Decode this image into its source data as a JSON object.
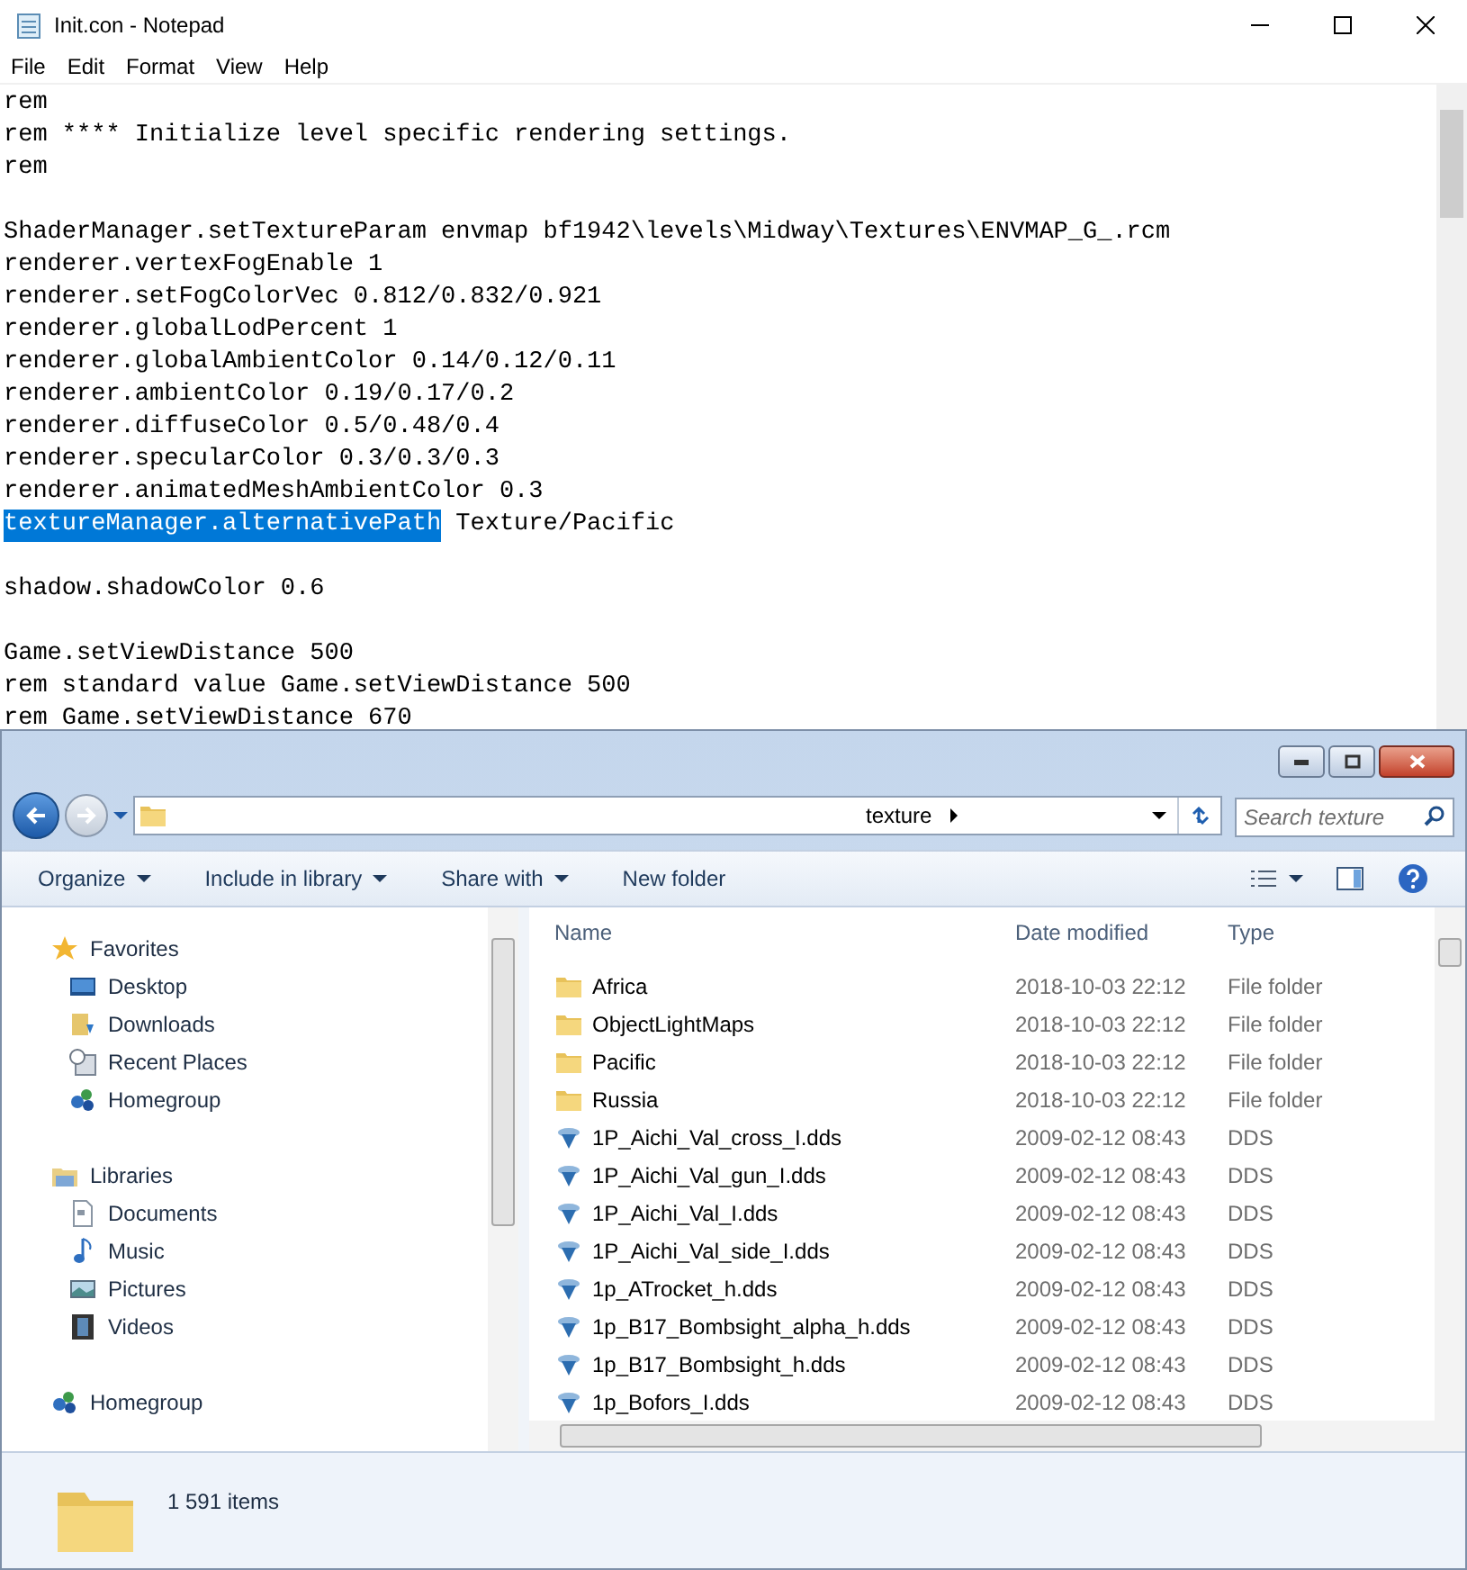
{
  "notepad": {
    "title": "Init.con - Notepad",
    "menu": [
      "File",
      "Edit",
      "Format",
      "View",
      "Help"
    ],
    "lines": [
      {
        "kind": "text",
        "text": "rem"
      },
      {
        "kind": "text",
        "text": "rem **** Initialize level specific rendering settings."
      },
      {
        "kind": "text",
        "text": "rem"
      },
      {
        "kind": "blank"
      },
      {
        "kind": "text",
        "text": "ShaderManager.setTextureParam envmap bf1942\\levels\\Midway\\Textures\\ENVMAP_G_.rcm"
      },
      {
        "kind": "text",
        "text": "renderer.vertexFogEnable 1"
      },
      {
        "kind": "text",
        "text": "renderer.setFogColorVec 0.812/0.832/0.921"
      },
      {
        "kind": "text",
        "text": "renderer.globalLodPercent 1"
      },
      {
        "kind": "text",
        "text": "renderer.globalAmbientColor 0.14/0.12/0.11"
      },
      {
        "kind": "text",
        "text": "renderer.ambientColor 0.19/0.17/0.2"
      },
      {
        "kind": "text",
        "text": "renderer.diffuseColor 0.5/0.48/0.4"
      },
      {
        "kind": "text",
        "text": "renderer.specularColor 0.3/0.3/0.3"
      },
      {
        "kind": "text",
        "text": "renderer.animatedMeshAmbientColor 0.3"
      },
      {
        "kind": "selection",
        "selected_text": "textureManager.alternativePath",
        "text": " Texture/Pacific"
      },
      {
        "kind": "blank"
      },
      {
        "kind": "text",
        "text": "shadow.shadowColor 0.6"
      },
      {
        "kind": "blank"
      },
      {
        "kind": "text",
        "text": "Game.setViewDistance 500"
      },
      {
        "kind": "text",
        "text": "rem standard value Game.setViewDistance 500"
      },
      {
        "kind": "text",
        "text": "rem Game.setViewDistance 670"
      }
    ]
  },
  "explorer": {
    "address": "texture",
    "search": {
      "placeholder": "Search texture"
    },
    "toolbar": [
      {
        "label": "Organize",
        "dropdown": true
      },
      {
        "label": "Include in library",
        "dropdown": true
      },
      {
        "label": "Share with",
        "dropdown": true
      },
      {
        "label": "New folder",
        "dropdown": false
      }
    ],
    "nav": [
      {
        "label": "Favorites",
        "children": [
          {
            "label": "Desktop"
          },
          {
            "label": "Downloads"
          },
          {
            "label": "Recent Places"
          },
          {
            "label": "Homegroup"
          }
        ]
      },
      {
        "label": "Libraries",
        "children": [
          {
            "label": "Documents"
          },
          {
            "label": "Music"
          },
          {
            "label": "Pictures"
          },
          {
            "label": "Videos"
          }
        ]
      },
      {
        "label": "Homegroup"
      }
    ],
    "columns": [
      "Name",
      "Date modified",
      "Type"
    ],
    "rows": [
      {
        "kind": "folder",
        "name": "Africa",
        "date": "2018-10-03 22:12",
        "type": "File folder"
      },
      {
        "kind": "folder",
        "name": "ObjectLightMaps",
        "date": "2018-10-03 22:12",
        "type": "File folder"
      },
      {
        "kind": "folder",
        "name": "Pacific",
        "date": "2018-10-03 22:12",
        "type": "File folder"
      },
      {
        "kind": "folder",
        "name": "Russia",
        "date": "2018-10-03 22:12",
        "type": "File folder"
      },
      {
        "kind": "dds",
        "name": "1P_Aichi_Val_cross_I.dds",
        "date": "2009-02-12 08:43",
        "type": "DDS"
      },
      {
        "kind": "dds",
        "name": "1P_Aichi_Val_gun_I.dds",
        "date": "2009-02-12 08:43",
        "type": "DDS"
      },
      {
        "kind": "dds",
        "name": "1P_Aichi_Val_I.dds",
        "date": "2009-02-12 08:43",
        "type": "DDS"
      },
      {
        "kind": "dds",
        "name": "1P_Aichi_Val_side_I.dds",
        "date": "2009-02-12 08:43",
        "type": "DDS"
      },
      {
        "kind": "dds",
        "name": "1p_ATrocket_h.dds",
        "date": "2009-02-12 08:43",
        "type": "DDS"
      },
      {
        "kind": "dds",
        "name": "1p_B17_Bombsight_alpha_h.dds",
        "date": "2009-02-12 08:43",
        "type": "DDS"
      },
      {
        "kind": "dds",
        "name": "1p_B17_Bombsight_h.dds",
        "date": "2009-02-12 08:43",
        "type": "DDS"
      },
      {
        "kind": "dds",
        "name": "1p_Bofors_I.dds",
        "date": "2009-02-12 08:43",
        "type": "DDS"
      }
    ],
    "status": "1 591 items"
  }
}
